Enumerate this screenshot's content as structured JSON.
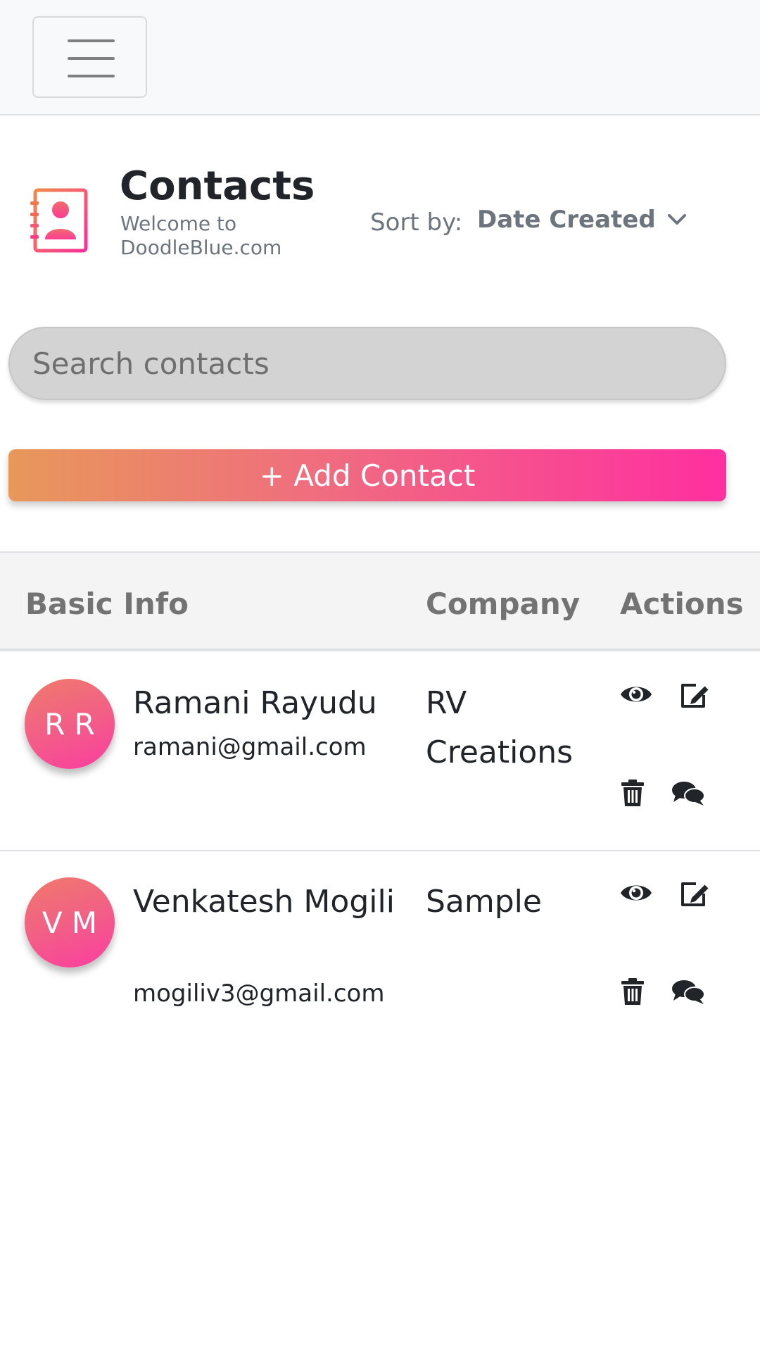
{
  "header": {
    "title": "Contacts",
    "subtitle": "Welcome to DoodleBlue.com",
    "sort_label": "Sort by:",
    "sort_value": "Date Created"
  },
  "search": {
    "placeholder": "Search contacts"
  },
  "add_button": {
    "label": "+ Add Contact"
  },
  "table": {
    "columns": [
      "Basic Info",
      "Company",
      "Actions"
    ],
    "rows": [
      {
        "initials": "R R",
        "name": "Ramani Rayudu",
        "email": "ramani@gmail.com",
        "company": "RV Creations"
      },
      {
        "initials": "V M",
        "name": "Venkatesh Mogili",
        "email": "mogiliv3@gmail.com",
        "company": "Sample"
      }
    ]
  },
  "icons": {
    "menu": "hamburger-menu-icon",
    "header": "contact-book-icon",
    "sort": "chevron-down-icon",
    "view": "eye-icon",
    "edit": "edit-icon",
    "delete": "trash-icon",
    "chat": "comments-icon"
  },
  "colors": {
    "accent_start": "#e8985a",
    "accent_end": "#ff2fa0",
    "heading_gray": "#737373",
    "text": "#212529"
  }
}
